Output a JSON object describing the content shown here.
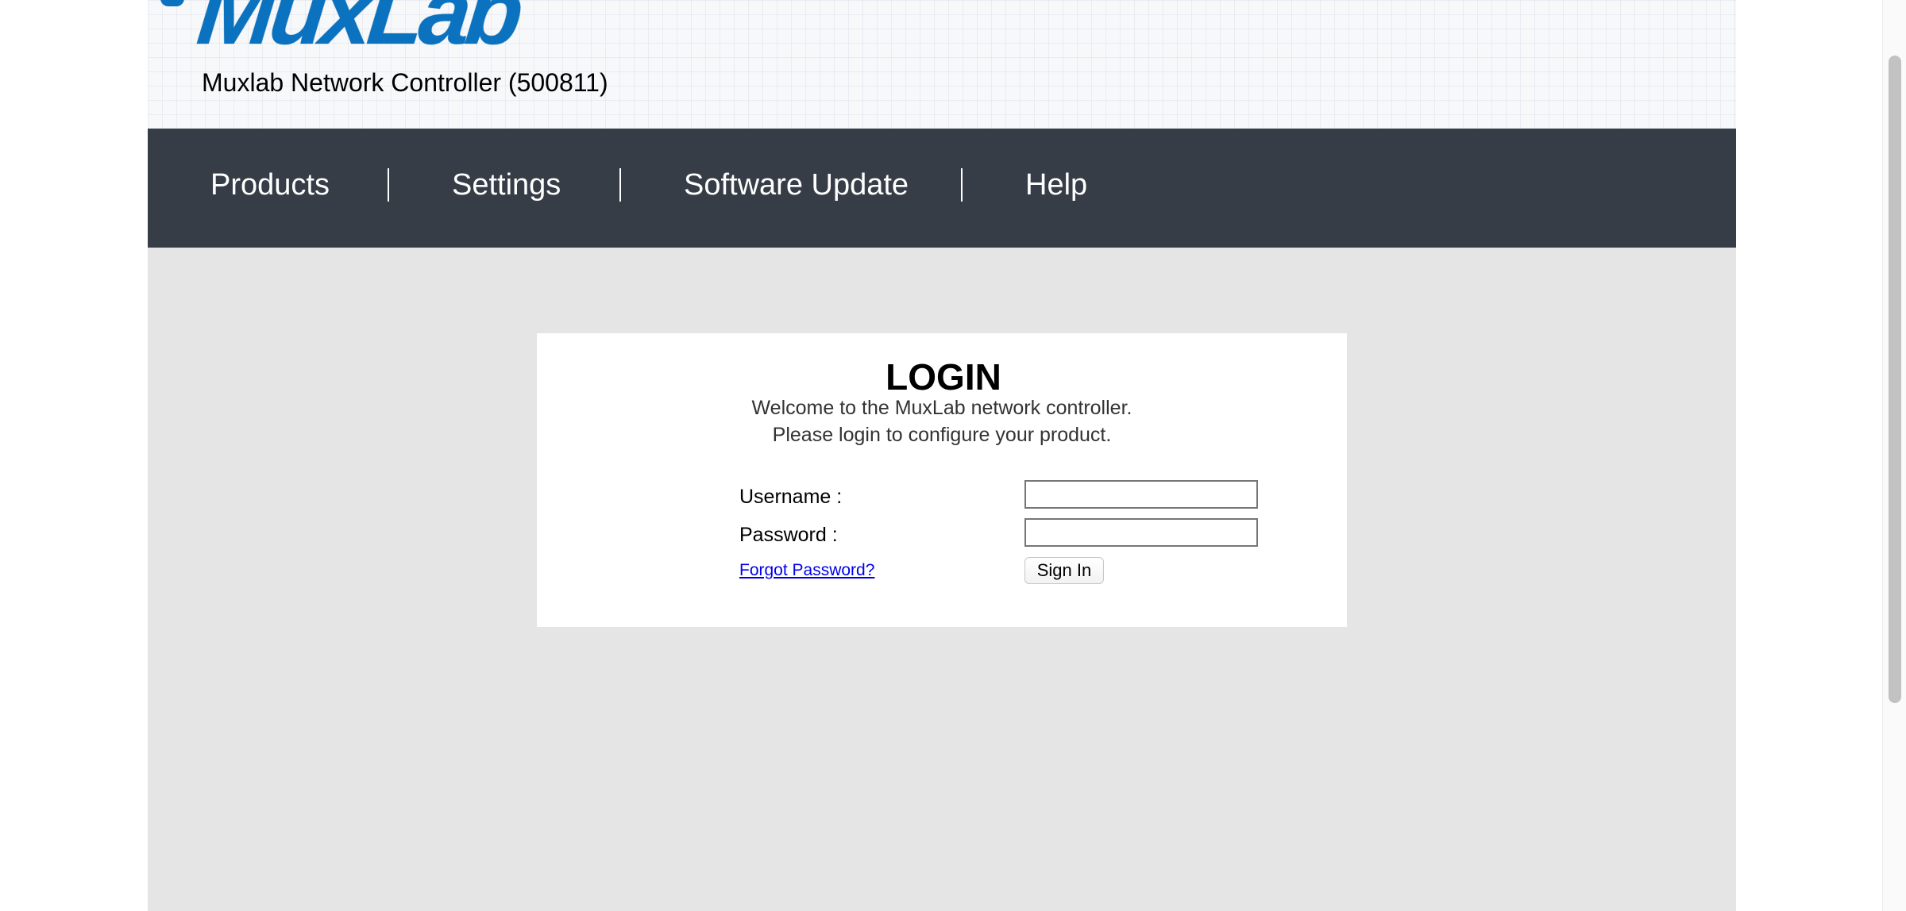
{
  "header": {
    "logo_text": "MuxLab",
    "subtitle": "Muxlab Network Controller (500811)"
  },
  "nav": {
    "items": [
      {
        "label": "Products"
      },
      {
        "label": "Settings"
      },
      {
        "label": "Software Update"
      },
      {
        "label": "Help"
      }
    ]
  },
  "login": {
    "title": "LOGIN",
    "welcome_line1": "Welcome to the MuxLab network controller.",
    "welcome_line2": "Please login to configure your product.",
    "username_label": "Username :",
    "username_value": "",
    "password_label": "Password :",
    "password_value": "",
    "forgot_link": "Forgot Password?",
    "signin_label": "Sign In"
  },
  "colors": {
    "navbar_bg": "#373d47",
    "content_bg": "#e5e5e5",
    "logo_blue": "#0b72bf",
    "link_blue": "#0000ee"
  },
  "icons": {
    "logo": "muxlab-logo-icon"
  }
}
